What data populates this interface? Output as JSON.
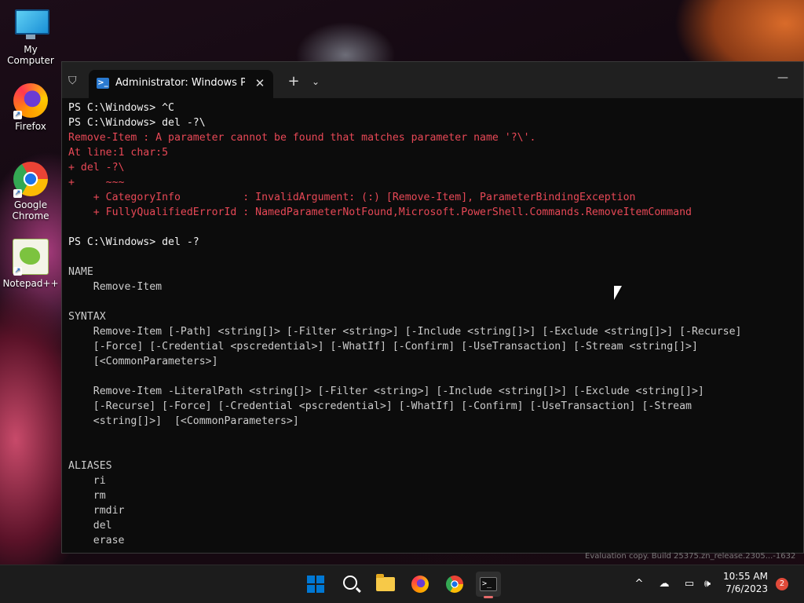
{
  "desktop": {
    "icons": [
      {
        "label": "My Computer",
        "icon": "computer-icon"
      },
      {
        "label": "Firefox",
        "icon": "firefox-icon"
      },
      {
        "label": "Google Chrome",
        "icon": "chrome-icon"
      },
      {
        "label": "Notepad++",
        "icon": "notepadpp-icon"
      }
    ],
    "watermark": "Evaluation copy. Build 25375.zn_release.2305...-1632"
  },
  "terminal": {
    "tab_title": "Administrator: Windows PowerShell",
    "new_tab_label": "+",
    "dropdown_label": "⌄",
    "close_label": "✕",
    "minimize_label": "—",
    "lines": [
      {
        "text": "PS C:\\Windows> ^C",
        "style": "cmd"
      },
      {
        "text": "PS C:\\Windows> del -?\\",
        "style": "cmd"
      },
      {
        "text": "Remove-Item : A parameter cannot be found that matches parameter name '?\\'.",
        "style": "err"
      },
      {
        "text": "At line:1 char:5",
        "style": "err"
      },
      {
        "text": "+ del -?\\",
        "style": "err"
      },
      {
        "text": "+     ~~~",
        "style": "err"
      },
      {
        "text": "    + CategoryInfo          : InvalidArgument: (:) [Remove-Item], ParameterBindingException",
        "style": "err"
      },
      {
        "text": "    + FullyQualifiedErrorId : NamedParameterNotFound,Microsoft.PowerShell.Commands.RemoveItemCommand",
        "style": "err"
      },
      {
        "text": "",
        "style": "out"
      },
      {
        "text": "PS C:\\Windows> del -?",
        "style": "cmd"
      },
      {
        "text": "",
        "style": "out"
      },
      {
        "text": "NAME",
        "style": "out"
      },
      {
        "text": "    Remove-Item",
        "style": "out"
      },
      {
        "text": "",
        "style": "out"
      },
      {
        "text": "SYNTAX",
        "style": "out"
      },
      {
        "text": "    Remove-Item [-Path] <string[]> [-Filter <string>] [-Include <string[]>] [-Exclude <string[]>] [-Recurse]",
        "style": "out"
      },
      {
        "text": "    [-Force] [-Credential <pscredential>] [-WhatIf] [-Confirm] [-UseTransaction] [-Stream <string[]>]",
        "style": "out"
      },
      {
        "text": "    [<CommonParameters>]",
        "style": "out"
      },
      {
        "text": "",
        "style": "out"
      },
      {
        "text": "    Remove-Item -LiteralPath <string[]> [-Filter <string>] [-Include <string[]>] [-Exclude <string[]>]",
        "style": "out"
      },
      {
        "text": "    [-Recurse] [-Force] [-Credential <pscredential>] [-WhatIf] [-Confirm] [-UseTransaction] [-Stream",
        "style": "out"
      },
      {
        "text": "    <string[]>]  [<CommonParameters>]",
        "style": "out"
      },
      {
        "text": "",
        "style": "out"
      },
      {
        "text": "",
        "style": "out"
      },
      {
        "text": "ALIASES",
        "style": "out"
      },
      {
        "text": "    ri",
        "style": "out"
      },
      {
        "text": "    rm",
        "style": "out"
      },
      {
        "text": "    rmdir",
        "style": "out"
      },
      {
        "text": "    del",
        "style": "out"
      },
      {
        "text": "    erase",
        "style": "out"
      }
    ]
  },
  "taskbar": {
    "apps": [
      "start-icon",
      "search-icon",
      "file-explorer-icon",
      "firefox-icon",
      "chrome-icon",
      "terminal-icon"
    ],
    "tray": {
      "chevron": "^",
      "time": "10:55 AM",
      "date": "7/6/2023",
      "notification_count": "2"
    }
  },
  "colors": {
    "error_text": "#e74856",
    "console_bg": "#0c0c0c",
    "accent": "#0078d4"
  }
}
